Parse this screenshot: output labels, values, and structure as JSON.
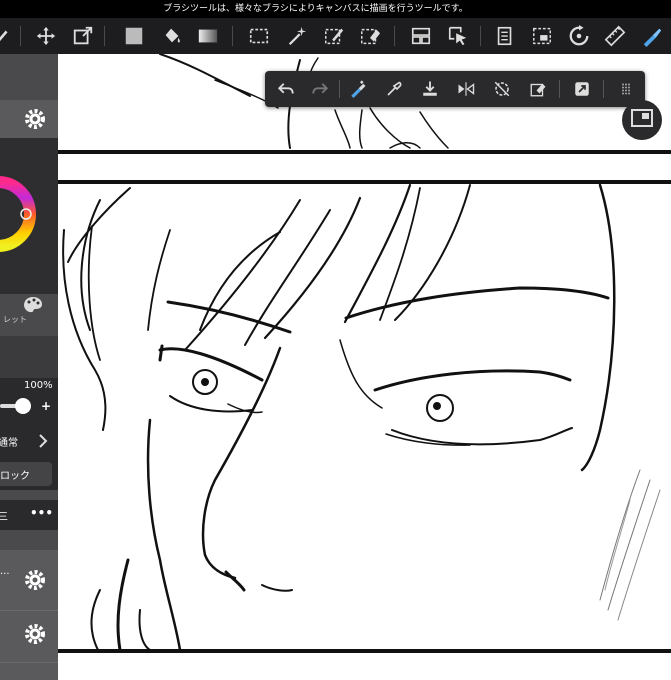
{
  "status": {
    "message": "ブラシツールは、様々なブラシによりキャンバスに描画を行うツールです。"
  },
  "toolbar": {
    "tools": [
      "brush-icon",
      "move-icon",
      "transform-icon",
      "fill-color-icon",
      "bucket-icon",
      "gradient-icon",
      "select-rect-icon",
      "magic-wand-icon",
      "select-pen-icon",
      "select-eraser-icon",
      "layout-icon",
      "select-layer-icon",
      "pages-icon",
      "frame-select-icon",
      "rotate-canvas-icon",
      "ruler-icon",
      "snap-icon"
    ]
  },
  "float_toolbar": {
    "items": [
      "undo-icon",
      "redo-icon",
      "pen-swap-icon",
      "eyedropper-icon",
      "download-icon",
      "flip-icon",
      "rotate-reset-icon",
      "clear-icon",
      "share-icon",
      "grip-icon"
    ]
  },
  "sidebar": {
    "palette_label": "レット",
    "opacity_value": "100%",
    "plus_label": "+",
    "blend_label": "通常",
    "lock_label": "ロック",
    "list_label": "三",
    "more_label": "•••",
    "dots_label": "..."
  },
  "colors": {
    "accent": "#e9a94a",
    "toolbar_bg": "#1d1d1f",
    "sidebar_bg": "#4a4a4c"
  }
}
